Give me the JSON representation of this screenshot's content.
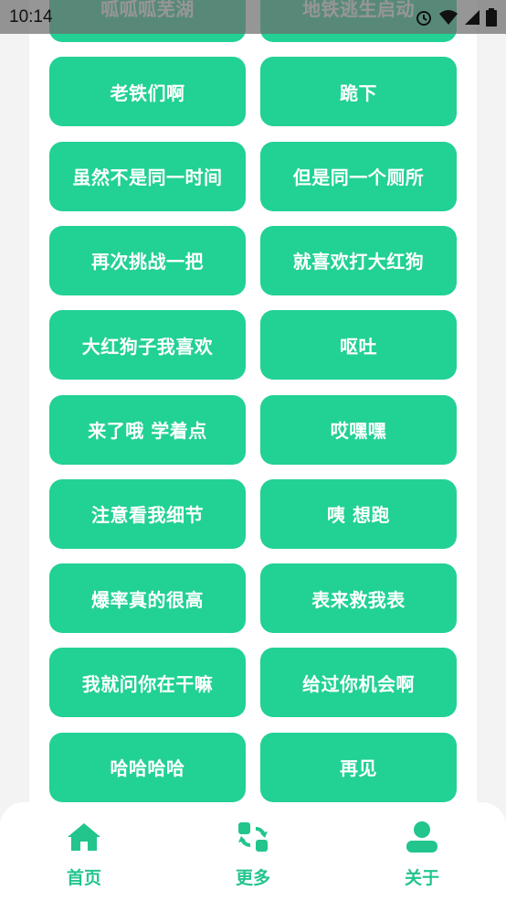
{
  "status_bar": {
    "time": "10:14",
    "icons": [
      "alarm-icon",
      "wifi-icon",
      "signal-icon",
      "battery-icon"
    ]
  },
  "colors": {
    "accent": "#22d194",
    "nav_accent": "#22c58c",
    "background": "#f2f3f2",
    "panel": "#ffffff"
  },
  "sound_buttons": [
    "呱呱呱芜湖",
    "地铁逃生启动",
    "老铁们啊",
    "跪下",
    "虽然不是同一时间",
    "但是同一个厕所",
    "再次挑战一把",
    "就喜欢打大红狗",
    "大红狗子我喜欢",
    "呕吐",
    "来了哦 学着点",
    "哎嘿嘿",
    "注意看我细节",
    "咦 想跑",
    "爆率真的很高",
    "表来救我表",
    "我就问你在干嘛",
    "给过你机会啊",
    "哈哈哈哈",
    "再见"
  ],
  "bottom_nav": {
    "items": [
      {
        "label": "首页",
        "icon": "home-icon"
      },
      {
        "label": "更多",
        "icon": "refresh-grid-icon"
      },
      {
        "label": "关于",
        "icon": "user-icon"
      }
    ]
  }
}
